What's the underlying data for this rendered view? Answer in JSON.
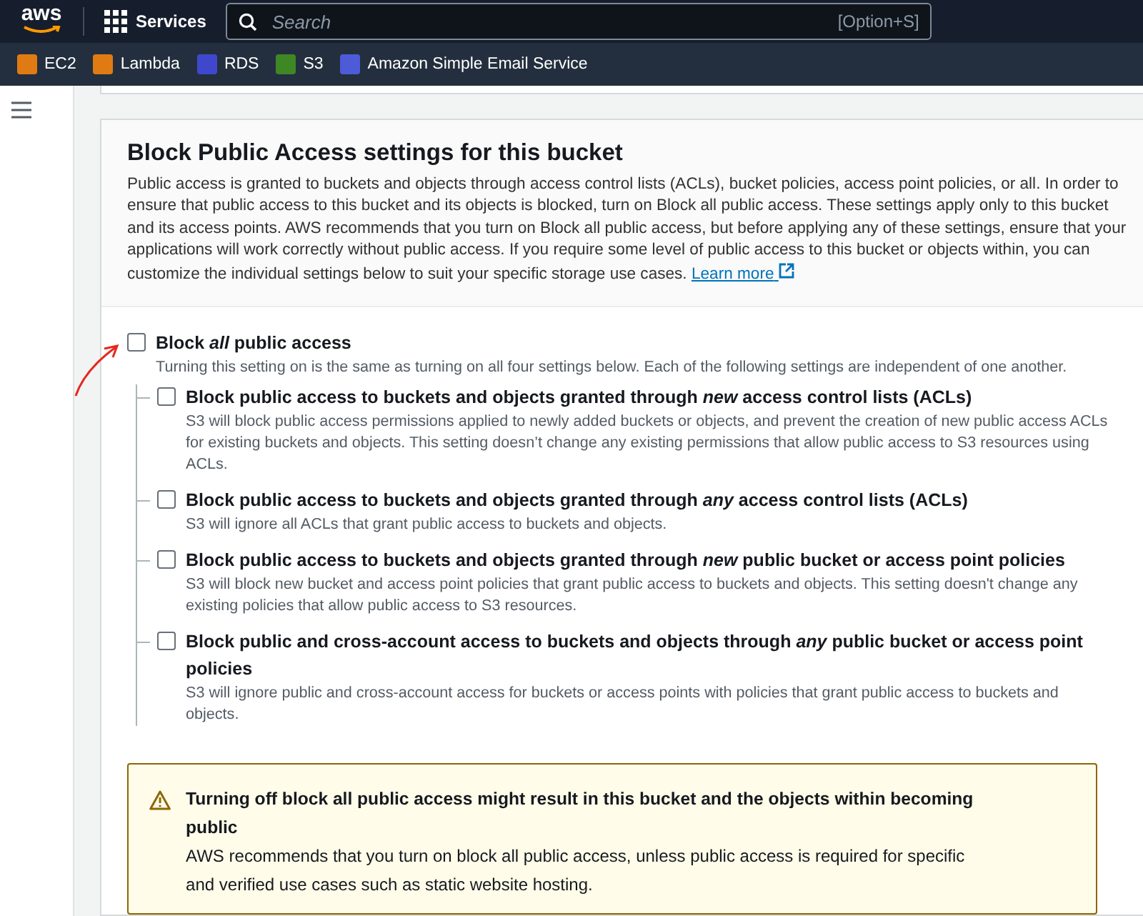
{
  "top_nav": {
    "logo": "aws",
    "services": "Services",
    "search": {
      "placeholder": "Search",
      "shortcut": "[Option+S]"
    }
  },
  "favorites": [
    {
      "label": "EC2",
      "color": "#e07b13"
    },
    {
      "label": "Lambda",
      "color": "#e07b13"
    },
    {
      "label": "RDS",
      "color": "#3f48cc"
    },
    {
      "label": "S3",
      "color": "#3f8624"
    },
    {
      "label": "Amazon Simple Email Service",
      "color": "#4d5bd9"
    }
  ],
  "panel": {
    "title": "Block Public Access settings for this bucket",
    "description": "Public access is granted to buckets and objects through access control lists (ACLs), bucket policies, access point policies, or all. In order to ensure that public access to this bucket and its objects is blocked, turn on Block all public access. These settings apply only to this bucket and its access points. AWS recommends that you turn on Block all public access, but before applying any of these settings, ensure that your applications will work correctly without public access. If you require some level of public access to this bucket or objects within, you can customize the individual settings below to suit your specific storage use cases.",
    "learn_more": "Learn more",
    "main_setting": {
      "label": "Block *all* public access",
      "description": "Turning this setting on is the same as turning on all four settings below. Each of the following settings are independent of one another.",
      "checked": false,
      "annotated": true
    },
    "settings": [
      {
        "label": "Block public access to buckets and objects granted through *new* access control lists (ACLs)",
        "description": "S3 will block public access permissions applied to newly added buckets or objects, and prevent the creation of new public access ACLs for existing buckets and objects. This setting doesn’t change any existing permissions that allow public access to S3 resources using ACLs.",
        "checked": false
      },
      {
        "label": "Block public access to buckets and objects granted through *any* access control lists (ACLs)",
        "description": "S3 will ignore all ACLs that grant public access to buckets and objects.",
        "checked": false
      },
      {
        "label": "Block public access to buckets and objects granted through *new* public bucket or access point policies",
        "description": "S3 will block new bucket and access point policies that grant public access to buckets and objects. This setting doesn't change any existing policies that allow public access to S3 resources.",
        "checked": false
      },
      {
        "label": "Block public and cross-account access to buckets and objects through *any* public bucket or access point policies",
        "description": "S3 will ignore public and cross-account access for buckets or access points with policies that grant public access to buckets and objects.",
        "checked": false
      }
    ],
    "warning": {
      "title": "Turning off block all public access might result in this bucket and the objects within becoming public",
      "text": "AWS recommends that you turn on block all public access, unless public access is required for specific and verified use cases such as static website hosting."
    }
  }
}
